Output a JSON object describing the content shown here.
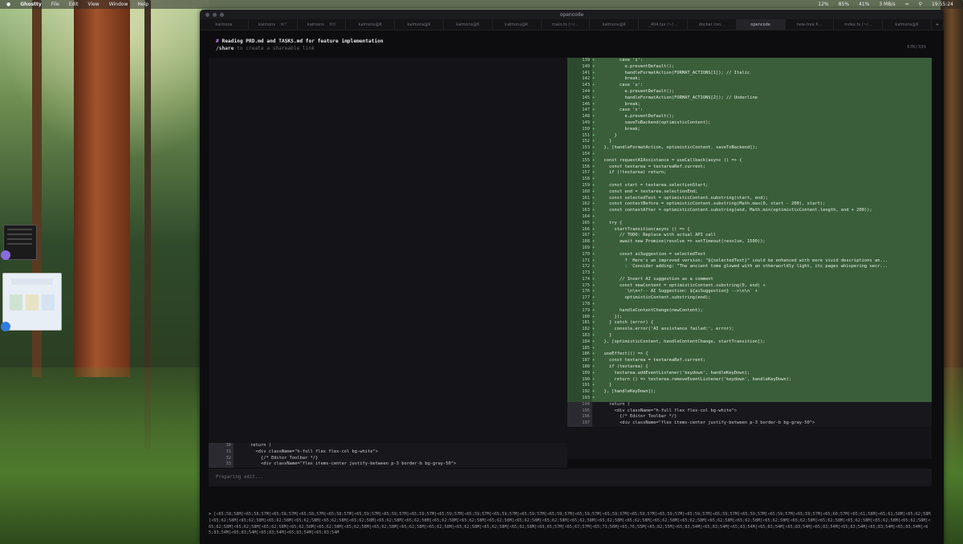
{
  "menubar": {
    "app": "Ghostty",
    "items": [
      "File",
      "Edit",
      "View",
      "Window",
      "Help"
    ],
    "status": [
      "12%",
      "85%",
      "41%",
      "3 MB/s",
      "19:55:24"
    ]
  },
  "window": {
    "title": "opencode"
  },
  "tabs": [
    {
      "label": "kalmons",
      "shortcut": ""
    },
    {
      "label": "kalmons",
      "shortcut": "⌘7"
    },
    {
      "label": "kalmons",
      "shortcut": "⌘8"
    },
    {
      "label": "kalmons@K",
      "shortcut": ""
    },
    {
      "label": "kalmons@K",
      "shortcut": ""
    },
    {
      "label": "kalmons@K",
      "shortcut": ""
    },
    {
      "label": "kalmons@K",
      "shortcut": ""
    },
    {
      "label": "main.ts (~/...",
      "shortcut": ""
    },
    {
      "label": "kalmons@K",
      "shortcut": ""
    },
    {
      "label": "_404.tsx (~/...",
      "shortcut": ""
    },
    {
      "label": "docker con...",
      "shortcut": ""
    },
    {
      "label": "opencode",
      "shortcut": "",
      "active": true
    },
    {
      "label": "new-tree fi...",
      "shortcut": ""
    },
    {
      "label": "index.ts (~/...",
      "shortcut": ""
    },
    {
      "label": "kalmons@K",
      "shortcut": ""
    }
  ],
  "header": {
    "hash": "#",
    "title": "Reading PRD.md and TASKS.md for feature implementation",
    "share_cmd": "/share",
    "share_rest": "to create a shareable link",
    "tokens": "67K/33%"
  },
  "left_pane": {
    "lines": [
      {
        "n": "30",
        "t": "    return ("
      },
      {
        "n": "31",
        "t": "      <div className=\"h-full flex flex-col bg-white\">"
      },
      {
        "n": "32",
        "t": "        {/* Editor Toolbar */}"
      },
      {
        "n": "33",
        "t": "        <div className=\"flex items-center justify-between p-3 border-b bg-gray-50\">"
      }
    ]
  },
  "right_pane": {
    "added": [
      {
        "n": "139",
        "t": "        case 'i':"
      },
      {
        "n": "140",
        "t": "          e.preventDefault();"
      },
      {
        "n": "141",
        "t": "          handleFormatAction(FORMAT_ACTIONS[1]); // Italic"
      },
      {
        "n": "142",
        "t": "          break;"
      },
      {
        "n": "143",
        "t": "        case 'u':"
      },
      {
        "n": "144",
        "t": "          e.preventDefault();"
      },
      {
        "n": "145",
        "t": "          handleFormatAction(FORMAT_ACTIONS[2]); // Underline"
      },
      {
        "n": "146",
        "t": "          break;"
      },
      {
        "n": "147",
        "t": "        case 's':"
      },
      {
        "n": "148",
        "t": "          e.preventDefault();"
      },
      {
        "n": "149",
        "t": "          saveToBackend(optimisticContent);"
      },
      {
        "n": "150",
        "t": "          break;"
      },
      {
        "n": "151",
        "t": "      }"
      },
      {
        "n": "152",
        "t": "    }"
      },
      {
        "n": "153",
        "t": "  }, [handleFormatAction, optimisticContent, saveToBackend]);"
      },
      {
        "n": "154",
        "t": ""
      },
      {
        "n": "155",
        "t": "  const requestAIAssistance = useCallback(async () => {"
      },
      {
        "n": "156",
        "t": "    const textarea = textareaRef.current;"
      },
      {
        "n": "157",
        "t": "    if (!textarea) return;"
      },
      {
        "n": "158",
        "t": ""
      },
      {
        "n": "159",
        "t": "    const start = textarea.selectionStart;"
      },
      {
        "n": "160",
        "t": "    const end = textarea.selectionEnd;"
      },
      {
        "n": "161",
        "t": "    const selectedText = optimisticContent.substring(start, end);"
      },
      {
        "n": "162",
        "t": "    const contextBefore = optimisticContent.substring(Math.max(0, start - 200), start);"
      },
      {
        "n": "163",
        "t": "    const contextAfter = optimisticContent.substring(end, Math.min(optimisticContent.length, end + 200));"
      },
      {
        "n": "164",
        "t": ""
      },
      {
        "n": "165",
        "t": "    try {"
      },
      {
        "n": "166",
        "t": "      startTransition(async () => {"
      },
      {
        "n": "167",
        "t": "        // TODO: Replace with actual API call"
      },
      {
        "n": "168",
        "t": "        await new Promise(resolve => setTimeout(resolve, 1500));"
      },
      {
        "n": "169",
        "t": ""
      },
      {
        "n": "170",
        "t": "        const aiSuggestion = selectedText"
      },
      {
        "n": "171",
        "t": "          ? `Here's an improved version: \"${selectedText}\" could be enhanced with more vivid descriptions an..."
      },
      {
        "n": "172",
        "t": "          : `Consider adding: \"The ancient tome glowed with an otherworldly light, its pages whispering secr..."
      },
      {
        "n": "173",
        "t": ""
      },
      {
        "n": "174",
        "t": "        // Insert AI suggestion as a comment"
      },
      {
        "n": "175",
        "t": "        const newContent = optimisticContent.substring(0, end) +"
      },
      {
        "n": "176",
        "t": "          `\\n\\n<!-- AI Suggestion: ${aiSuggestion} -->\\n\\n` +"
      },
      {
        "n": "177",
        "t": "          optimisticContent.substring(end);"
      },
      {
        "n": "178",
        "t": ""
      },
      {
        "n": "179",
        "t": "        handleContentChange(newContent);"
      },
      {
        "n": "180",
        "t": "      });"
      },
      {
        "n": "181",
        "t": "    } catch (error) {"
      },
      {
        "n": "182",
        "t": "      console.error('AI assistance failed:', error);"
      },
      {
        "n": "183",
        "t": "    }"
      },
      {
        "n": "184",
        "t": "  }, [optimisticContent, handleContentChange, startTransition]);"
      },
      {
        "n": "185",
        "t": ""
      },
      {
        "n": "186",
        "t": "  useEffect(() => {"
      },
      {
        "n": "187",
        "t": "    const textarea = textareaRef.current;"
      },
      {
        "n": "188",
        "t": "    if (textarea) {"
      },
      {
        "n": "189",
        "t": "      textarea.addEventListener('keydown', handleKeyDown);"
      },
      {
        "n": "190",
        "t": "      return () => textarea.removeEventListener('keydown', handleKeyDown);"
      },
      {
        "n": "191",
        "t": "    }"
      },
      {
        "n": "192",
        "t": "  }, [handleKeyDown]);"
      },
      {
        "n": "193",
        "t": ""
      }
    ],
    "context": [
      {
        "n": "194",
        "t": "    return ("
      },
      {
        "n": "195",
        "t": "      <div className=\"h-full flex flex-col bg-white\">"
      },
      {
        "n": "196",
        "t": "        {/* Editor Toolbar */}"
      },
      {
        "n": "197",
        "t": "        <div className=\"flex items-center justify-between p-3 border-b bg-gray-50\">"
      }
    ]
  },
  "status_text": "Preparing edit...",
  "escape_prompt": ">",
  "escape_output": "[<65;58;58M[<65;58;57M[<65;58;57M[<65;58;57M[<65;58;57M[<65;59;57M[<65;59;57M[<65;59;57M[<65;59;57M[<65;59;57M[<65;59;57M[<65;59;57M[<65;59;57M[<65;59;57M[<65;59;57M[<65;59;57M[<65;59;57M[<65;59;57M[<65;59;57M[<65;59;57M[<65;59;57M[<65;59;57M[<65;60;57M[<65;61;58M[<65;61;58M[<65;62;58M[<65;62;58M[<65;62;58M[<65;62;58M[<65;62;58M[<65;62;58M[<65;62;58M[<65;62;58M[<65;62;58M[<65;62;58M[<65;62;58M[<65;62;58M[<65;62;58M[<65;62;58M[<65;62;58M[<65;62;58M[<65;62;58M[<65;62;58M[<65;62;58M[<65;62;58M[<65;62;58M[<65;62;58M[<65;62;58M[<65;62;58M[<65;62;58M[<65;62;58M[<65;62;58M[<65;62;58M[<65;62;58M[<65;62;58M[<65;62;58M[<65;62;58M[<65;62;58M[<65;62;58M[<65;62;58M[<65;62;58M[<65;62;58M[<65;62;58M[<65;62;58M[<65;65;57M[<65;67;57M[<65;73;56M[<65;76;55M[<65;82;55M[<65;83;54M[<65;83;54M[<65;83;54M[<65;83;54M[<65;83;54M[<65;83;54M[<65;83;54M[<65;83;54M[<65;83;54M[<65;83;54M[<65;83;54M[<65;83;54M[<65;83;54M[<65;83;54M"
}
